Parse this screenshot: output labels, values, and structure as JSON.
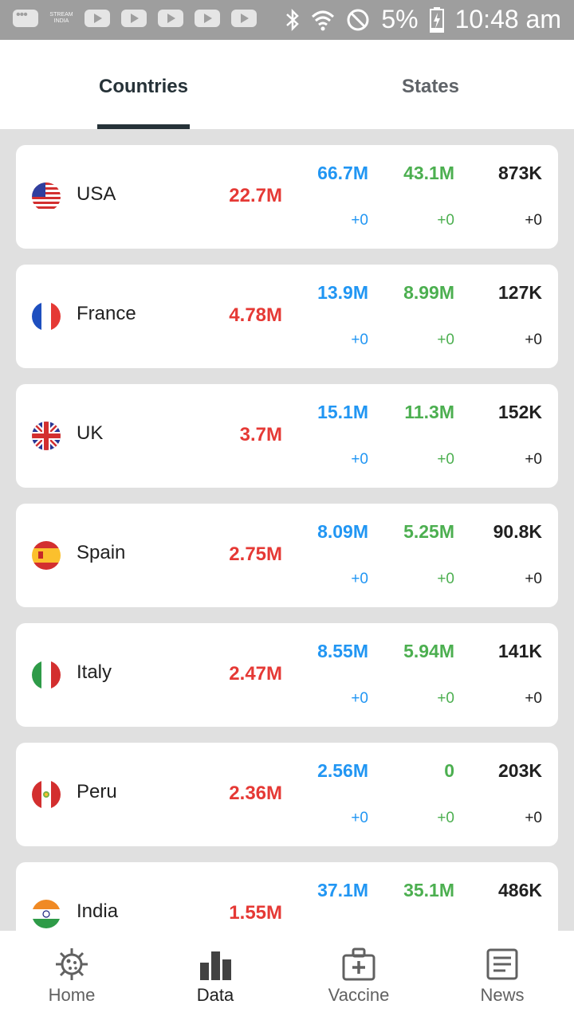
{
  "status_bar": {
    "battery": "5%",
    "time": "10:48 am",
    "stream_label": "STREAM INDIA"
  },
  "tabs": [
    {
      "label": "Countries",
      "active": true
    },
    {
      "label": "States",
      "active": false
    }
  ],
  "countries": [
    {
      "name": "USA",
      "flag": "usa-flag-icon",
      "confirmed": "22.7M",
      "active": "66.7M",
      "active_delta": "+0",
      "recovered": "43.1M",
      "recovered_delta": "+0",
      "deaths": "873K",
      "deaths_delta": "+0"
    },
    {
      "name": "France",
      "flag": "france-flag-icon",
      "confirmed": "4.78M",
      "active": "13.9M",
      "active_delta": "+0",
      "recovered": "8.99M",
      "recovered_delta": "+0",
      "deaths": "127K",
      "deaths_delta": "+0"
    },
    {
      "name": "UK",
      "flag": "uk-flag-icon",
      "confirmed": "3.7M",
      "active": "15.1M",
      "active_delta": "+0",
      "recovered": "11.3M",
      "recovered_delta": "+0",
      "deaths": "152K",
      "deaths_delta": "+0"
    },
    {
      "name": "Spain",
      "flag": "spain-flag-icon",
      "confirmed": "2.75M",
      "active": "8.09M",
      "active_delta": "+0",
      "recovered": "5.25M",
      "recovered_delta": "+0",
      "deaths": "90.8K",
      "deaths_delta": "+0"
    },
    {
      "name": "Italy",
      "flag": "italy-flag-icon",
      "confirmed": "2.47M",
      "active": "8.55M",
      "active_delta": "+0",
      "recovered": "5.94M",
      "recovered_delta": "+0",
      "deaths": "141K",
      "deaths_delta": "+0"
    },
    {
      "name": "Peru",
      "flag": "peru-flag-icon",
      "confirmed": "2.36M",
      "active": "2.56M",
      "active_delta": "+0",
      "recovered": "0",
      "recovered_delta": "+0",
      "deaths": "203K",
      "deaths_delta": "+0"
    },
    {
      "name": "India",
      "flag": "india-flag-icon",
      "confirmed": "1.55M",
      "active": "37.1M",
      "active_delta": "",
      "recovered": "35.1M",
      "recovered_delta": "",
      "deaths": "486K",
      "deaths_delta": ""
    }
  ],
  "bottom_nav": [
    {
      "label": "Home",
      "icon": "virus-icon",
      "active": false
    },
    {
      "label": "Data",
      "icon": "bar-chart-icon",
      "active": true
    },
    {
      "label": "Vaccine",
      "icon": "medical-kit-icon",
      "active": false
    },
    {
      "label": "News",
      "icon": "newspaper-icon",
      "active": false
    }
  ],
  "colors": {
    "confirmed": "#e53935",
    "active": "#2196f3",
    "recovered": "#4caf50",
    "deaths": "#212121"
  }
}
